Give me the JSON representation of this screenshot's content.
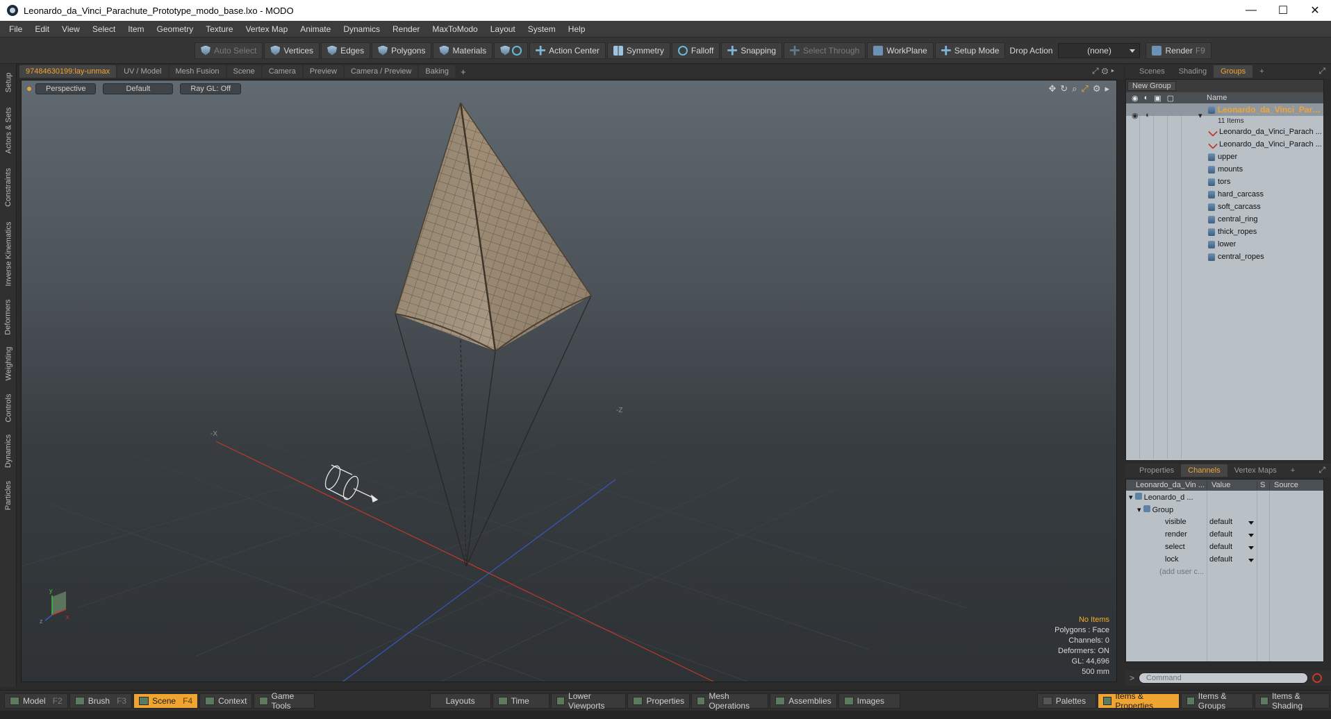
{
  "window": {
    "title": "Leonardo_da_Vinci_Parachute_Prototype_modo_base.lxo - MODO",
    "minimize": "—",
    "maximize": "☐",
    "close": "✕"
  },
  "menu": [
    "File",
    "Edit",
    "View",
    "Select",
    "Item",
    "Geometry",
    "Texture",
    "Vertex Map",
    "Animate",
    "Dynamics",
    "Render",
    "MaxToModo",
    "Layout",
    "System",
    "Help"
  ],
  "toolbar": {
    "auto_select": "Auto Select",
    "vertices": "Vertices",
    "edges": "Edges",
    "polygons": "Polygons",
    "materials": "Materials",
    "action_center": "Action Center",
    "symmetry": "Symmetry",
    "falloff": "Falloff",
    "snapping": "Snapping",
    "select_through": "Select Through",
    "workplane": "WorkPlane",
    "setup_mode": "Setup Mode",
    "drop_action_label": "Drop Action",
    "drop_action_value": "(none)",
    "render": "Render",
    "render_key": "F9"
  },
  "left_tabs": [
    "Setup",
    "Actors & Sets",
    "Constraints",
    "Inverse Kinematics",
    "Deformers",
    "Weighting",
    "Controls",
    "Dynamics",
    "Particles"
  ],
  "viewport_tabs": [
    "97484630199:lay-unmax",
    "UV / Model",
    "Mesh Fusion",
    "Scene",
    "Camera",
    "Preview",
    "Camera / Preview",
    "Baking"
  ],
  "viewport_tab_add": "+",
  "viewport": {
    "view": "Perspective",
    "shading": "Default",
    "raygl": "Ray GL: Off",
    "info": {
      "items": "No Items",
      "polygons": "Polygons : Face",
      "channels": "Channels: 0",
      "deformers": "Deformers: ON",
      "gl": "GL: 44,696",
      "scale": "500 mm"
    }
  },
  "right_top_tabs": [
    "Scenes",
    "Shading",
    "Groups"
  ],
  "right_top_add": "+",
  "groups": {
    "new_group": "New Group",
    "header_name": "Name",
    "root": "Leonardo_da_Vinci_Para ...",
    "count": "11 Items",
    "items": [
      "Leonardo_da_Vinci_Parach ...",
      "Leonardo_da_Vinci_Parach ...",
      "upper",
      "mounts",
      "tors",
      "hard_carcass",
      "soft_carcass",
      "central_ring",
      "thick_ropes",
      "lower",
      "central_ropes"
    ]
  },
  "right_mid_tabs": [
    "Properties",
    "Channels",
    "Vertex Maps"
  ],
  "right_mid_add": "+",
  "channels": {
    "header": {
      "name": "Leonardo_da_Vin ...",
      "value": "Value",
      "s": "S",
      "source": "Source"
    },
    "root": "Leonardo_d ...",
    "group": "Group",
    "rows": [
      {
        "name": "visible",
        "value": "default"
      },
      {
        "name": "render",
        "value": "default"
      },
      {
        "name": "select",
        "value": "default"
      },
      {
        "name": "lock",
        "value": "default"
      }
    ],
    "add_user": "(add user c..."
  },
  "command": {
    "prompt": ">",
    "placeholder": "Command"
  },
  "bottom": {
    "model": "Model",
    "model_key": "F2",
    "brush": "Brush",
    "brush_key": "F3",
    "scene": "Scene",
    "scene_key": "F4",
    "context": "Context",
    "game_tools": "Game Tools",
    "layouts": "Layouts",
    "time": "Time",
    "lower_viewports": "Lower Viewports",
    "properties": "Properties",
    "mesh_operations": "Mesh Operations",
    "assemblies": "Assemblies",
    "images": "Images",
    "palettes": "Palettes",
    "items_properties": "Items & Properties",
    "items_groups": "Items & Groups",
    "items_shading": "Items & Shading"
  },
  "colors": {
    "accent": "#f0a533",
    "axis_x": "#c0392b",
    "axis_z": "#3a57c4",
    "canopy": "#9a8a72"
  }
}
